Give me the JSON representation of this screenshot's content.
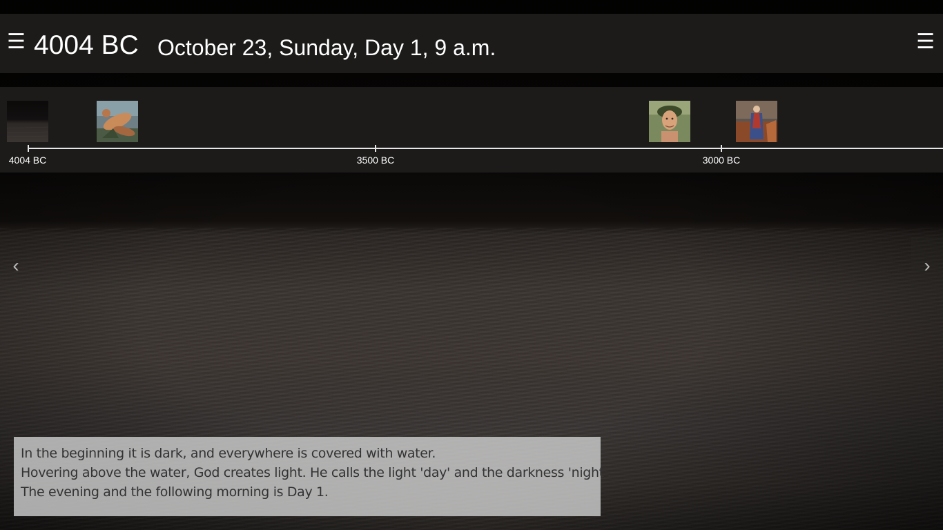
{
  "header": {
    "menu_left_icon": "☰",
    "year": "4004 BC",
    "date": "October 23, Sunday, Day 1, 9 a.m.",
    "menu_right_icon": "☰"
  },
  "timeline": {
    "thumbnails": [
      {
        "icon": "dark-water-thumbnail"
      },
      {
        "icon": "creation-painting-thumbnail"
      },
      {
        "icon": "portrait-painting-thumbnail"
      },
      {
        "icon": "prophet-painting-thumbnail"
      }
    ],
    "axis_labels": [
      "4004 BC",
      "3500 BC",
      "3000 BC"
    ]
  },
  "nav": {
    "prev": "‹",
    "next": "›"
  },
  "caption": {
    "lines": [
      "In the beginning it is dark, and everywhere is covered with water.",
      "Hovering above the water, God creates light. He calls the light 'day' and the darkness 'night'.",
      "The evening and the following morning is Day 1."
    ]
  },
  "colors": {
    "header_bg": "#1c1b1a",
    "caption_bg": "#cdcdcd",
    "caption_text": "#333333",
    "axis": "#e8e8e8"
  }
}
